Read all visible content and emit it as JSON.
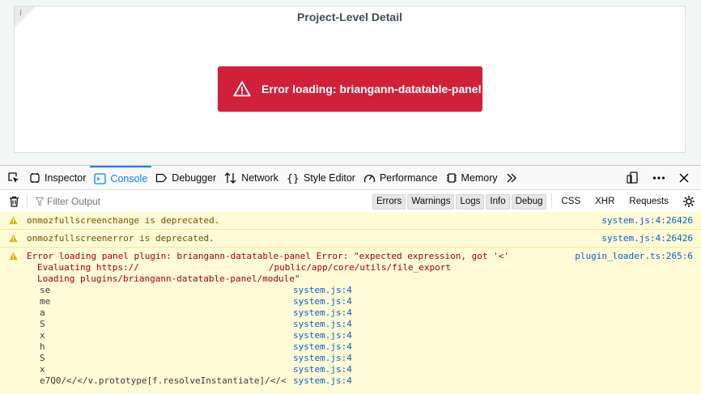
{
  "panel": {
    "title": "Project-Level Detail",
    "info_glyph": "i",
    "error_message": "Error loading: briangann-datatable-panel"
  },
  "devtools": {
    "tabs": [
      {
        "label": "Inspector",
        "icon": "inspector-icon"
      },
      {
        "label": "Console",
        "icon": "console-icon",
        "active": true
      },
      {
        "label": "Debugger",
        "icon": "debugger-icon"
      },
      {
        "label": "Network",
        "icon": "network-icon"
      },
      {
        "label": "Style Editor",
        "icon": "style-editor-icon"
      },
      {
        "label": "Performance",
        "icon": "performance-icon"
      },
      {
        "label": "Memory",
        "icon": "memory-icon"
      }
    ],
    "filter_placeholder": "Filter Output",
    "filter_buttons": [
      "Errors",
      "Warnings",
      "Logs",
      "Info",
      "Debug"
    ],
    "extra_filters": [
      "CSS",
      "XHR",
      "Requests"
    ],
    "messages": [
      {
        "text": "onmozfullscreenchange is deprecated.",
        "location": "system.js:4:26426"
      },
      {
        "text": "onmozfullscreenerror is deprecated.",
        "location": "system.js:4:26426"
      }
    ],
    "error": {
      "line1": "Error loading panel plugin: briangann-datatable-panel Error: \"expected expression, got '<'",
      "line2_prefix": "Evaluating https://",
      "line2_suffix": "/public/app/core/utils/file_export",
      "line3": "Loading plugins/briangann-datatable-panel/module\"",
      "location": "plugin_loader.ts:265:6",
      "stack": [
        {
          "fn": "se",
          "loc": "system.js:4"
        },
        {
          "fn": "me",
          "loc": "system.js:4"
        },
        {
          "fn": "a",
          "loc": "system.js:4"
        },
        {
          "fn": "S",
          "loc": "system.js:4"
        },
        {
          "fn": "x",
          "loc": "system.js:4"
        },
        {
          "fn": "h",
          "loc": "system.js:4"
        },
        {
          "fn": "S",
          "loc": "system.js:4"
        },
        {
          "fn": "x",
          "loc": "system.js:4"
        },
        {
          "fn": "e7Q0/</</v.prototype[f.resolveInstantiate]/</<",
          "loc": "system.js:4"
        }
      ]
    }
  },
  "colors": {
    "error_bg": "#d0213b",
    "accent": "#0a84ff",
    "warning_bg": "#fffbd6",
    "link": "#0a5ec7"
  }
}
